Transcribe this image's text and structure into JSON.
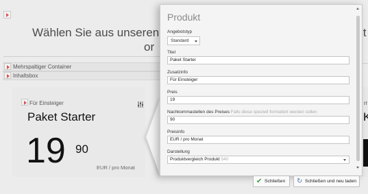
{
  "background": {
    "heading_line1": "Wählen Sie aus unseren P",
    "heading_line1_right": "lt",
    "heading_line2": "or",
    "containers": [
      "Mehrspaltiger Container",
      "Inhaltsbox"
    ],
    "card": {
      "tagline": "Für Einsteiger",
      "title": "Paket Starter",
      "price_main": "19",
      "price_cents": "90",
      "price_info": "EUR / pro Monat"
    },
    "right_fragment_small": "rr",
    "right_fragment_large": "K"
  },
  "modal": {
    "title": "Produkt",
    "fields": {
      "angebotstyp": {
        "label": "Angebotstyp",
        "value": "Standard"
      },
      "titel": {
        "label": "Titel",
        "value": "Paket Starter"
      },
      "zusatzinfo": {
        "label": "Zusatzinfo",
        "value": "Für Einsteiger"
      },
      "preis": {
        "label": "Preis",
        "value": "19"
      },
      "nachkomma": {
        "label": "Nachkommastellen des Preises",
        "hint": "Falls diese speziell formatiert werden sollen",
        "value": "90"
      },
      "preisinfo": {
        "label": "Preisinfo",
        "value": "EUR / pro Monat"
      },
      "darstellung": {
        "label": "Darstellung",
        "value": "Produktvergleich Produkt",
        "value_suffix": "540"
      }
    },
    "buttons": {
      "close": "Schließen",
      "close_reload": "Schließen und neu laden"
    }
  },
  "colors": {
    "accent_red": "#d9534f",
    "check_green": "#3a9a3a",
    "refresh_blue": "#5578a8"
  }
}
